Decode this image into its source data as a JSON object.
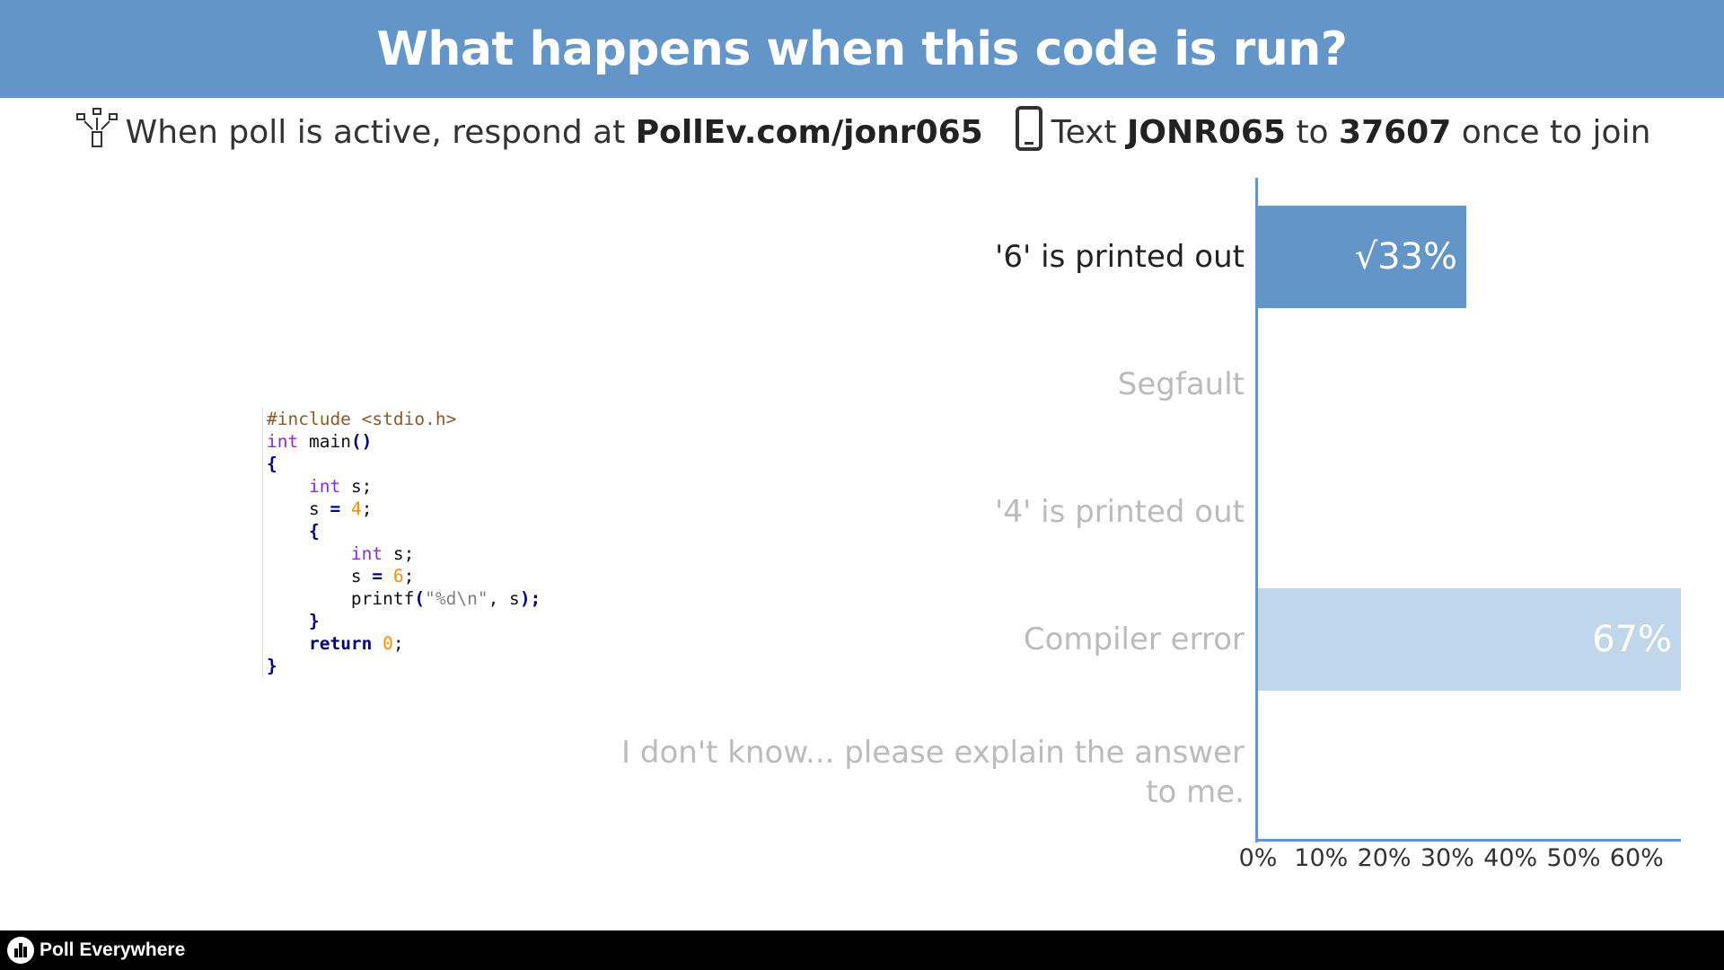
{
  "header": {
    "title": "What happens when this code is run?"
  },
  "instructions": {
    "web_prefix": "When poll is active, respond at",
    "web_url": "PollEv.com/jonr065",
    "text_prefix": "Text",
    "text_code": "JONR065",
    "text_to": "to",
    "text_number": "37607",
    "text_suffix": "once to join"
  },
  "code": {
    "line1": "#include <stdio.h>",
    "line2_kw": "int",
    "line2_rest": " main",
    "line2_paren": "()",
    "brace_open": "{",
    "brace_close": "}",
    "int_kw": "int",
    "decl_rest": " s;",
    "s": "s ",
    "eq": "=",
    "val4": "4",
    "val6": "6",
    "semi": ";",
    "printf": "printf",
    "fmt": "\"%d\\n\"",
    "printf_args": ", s",
    "printf_end": ");",
    "return_kw": "return",
    "val0": "0"
  },
  "chart_data": {
    "type": "bar",
    "orientation": "horizontal",
    "categories": [
      "'6' is printed out",
      "Segfault",
      "'4' is printed out",
      "Compiler error",
      "I don't know... please explain the answer to me."
    ],
    "values": [
      33,
      0,
      0,
      67,
      0
    ],
    "value_labels": [
      "√33%",
      "",
      "",
      "67%",
      ""
    ],
    "correct": [
      true,
      false,
      false,
      false,
      false
    ],
    "xlim": [
      0,
      67
    ],
    "x_ticks": [
      "0%",
      "10%",
      "20%",
      "30%",
      "40%",
      "50%",
      "60%"
    ],
    "colors": {
      "correct": "#6495c8",
      "other": "#c0d6ea",
      "axis": "#6495c8"
    }
  },
  "footer": {
    "brand": "Poll Everywhere"
  },
  "colors": {
    "header_bg": "#6495c8",
    "footer_bg": "#000000"
  }
}
